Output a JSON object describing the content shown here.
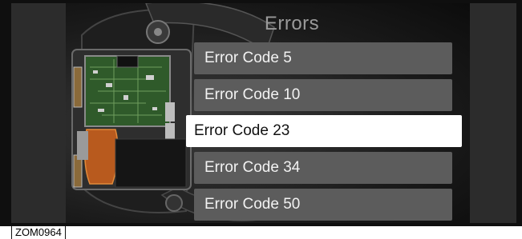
{
  "screen": {
    "title": "Errors",
    "items": [
      {
        "label": "Error Code 5",
        "selected": false
      },
      {
        "label": "Error Code 10",
        "selected": false
      },
      {
        "label": "Error Code 23",
        "selected": true
      },
      {
        "label": "Error Code 34",
        "selected": false
      },
      {
        "label": "Error Code 50",
        "selected": false
      }
    ]
  },
  "figure": {
    "reference_code": "ZOM0964"
  },
  "colors": {
    "item_background": "#5c5c5c",
    "item_selected_background": "#ffffff",
    "title_text": "#9a9a9a"
  },
  "icons": {
    "background": "sensor-circuit-board-illustration"
  }
}
